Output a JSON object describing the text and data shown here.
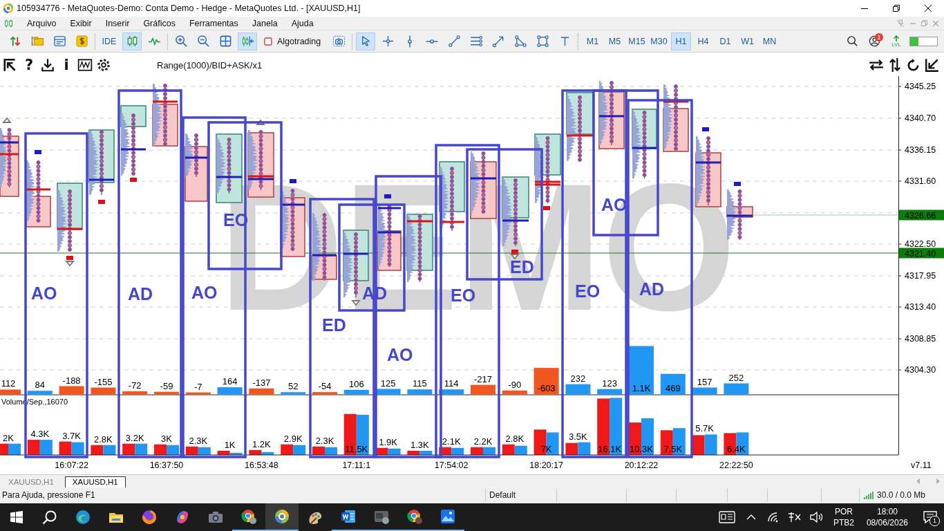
{
  "window": {
    "title": "105934776 - MetaQuotes-Demo: Conta Demo - Hedge - MetaQuotes Ltd. - [XAUUSD,H1]"
  },
  "menu": [
    "Arquivo",
    "Exibir",
    "Inserir",
    "Gráficos",
    "Ferramentas",
    "Janela",
    "Ajuda"
  ],
  "toolbar": {
    "ide_label": "IDE",
    "candles_selected": true,
    "autoscroll_selected": true,
    "algotrading": {
      "label": "Algotrading",
      "enabled": false
    },
    "cursor_selected": true,
    "timeframes": [
      {
        "label": "M1",
        "selected": false
      },
      {
        "label": "M5",
        "selected": false
      },
      {
        "label": "M15",
        "selected": false
      },
      {
        "label": "M30",
        "selected": false
      },
      {
        "label": "H1",
        "selected": true
      },
      {
        "label": "H4",
        "selected": false
      },
      {
        "label": "D1",
        "selected": false
      },
      {
        "label": "W1",
        "selected": false
      },
      {
        "label": "MN",
        "selected": false
      }
    ],
    "notification_count": "1",
    "lvl_label": "LVL",
    "meter": {
      "level": 0.3
    }
  },
  "chart": {
    "help_glyph": "?",
    "info_glyph": "i",
    "indicator": "Range(1000)/BID+ASK/x1",
    "watermark": "DEMO",
    "annotations": [
      {
        "label": "AO"
      },
      {
        "label": "AD"
      },
      {
        "label": "AO"
      },
      {
        "label": "EO"
      },
      {
        "label": "ED"
      },
      {
        "label": "AD"
      },
      {
        "label": "AO"
      },
      {
        "label": "EO"
      },
      {
        "label": "ED"
      },
      {
        "label": "EO"
      },
      {
        "label": "AO"
      },
      {
        "label": "AD"
      }
    ],
    "price_axis": {
      "ticks": [
        "4345.25",
        "4340.70",
        "4336.15",
        "4331.60",
        "4322.50",
        "4317.95",
        "4313.40",
        "4308.85",
        "4304.30"
      ],
      "markers": [
        {
          "label": "4326.66"
        },
        {
          "label": "4321.40"
        }
      ]
    },
    "delta_row": [
      {
        "label": "112",
        "color": "#f0561d"
      },
      {
        "label": "84",
        "color": "#2196f3"
      },
      {
        "label": "-188",
        "color": "#f0561d"
      },
      {
        "label": "-155",
        "color": "#f0561d"
      },
      {
        "label": "-72",
        "color": "#f0561d"
      },
      {
        "label": "-59",
        "color": "#f0561d"
      },
      {
        "label": "-7",
        "color": "#f0561d"
      },
      {
        "label": "164",
        "color": "#2196f3"
      },
      {
        "label": "-137",
        "color": "#f0561d"
      },
      {
        "label": "52",
        "color": "#2196f3"
      },
      {
        "label": "-54",
        "color": "#f0561d"
      },
      {
        "label": "106",
        "color": "#2196f3"
      },
      {
        "label": "125",
        "color": "#2196f3"
      },
      {
        "label": "115",
        "color": "#2196f3"
      },
      {
        "label": "114",
        "color": "#2196f3"
      },
      {
        "label": "-217",
        "color": "#f0561d"
      },
      {
        "label": "-90",
        "color": "#f0561d"
      },
      {
        "label": "-603",
        "color": "#f0561d"
      },
      {
        "label": "232",
        "color": "#2196f3"
      },
      {
        "label": "123",
        "color": "#2196f3"
      },
      {
        "label": "1.1K",
        "color": "#2196f3"
      },
      {
        "label": "469",
        "color": "#2196f3"
      },
      {
        "label": "157",
        "color": "#2196f3"
      },
      {
        "label": "252",
        "color": "#2196f3"
      }
    ],
    "volume_window": {
      "title": "Volume/Sep.,16070",
      "totals": [
        "2K",
        "4.3K",
        "3.7K",
        "2.8K",
        "3.2K",
        "3K",
        "2.3K",
        "1K",
        "1.2K",
        "2.9K",
        "2.3K",
        "11.5K",
        "1.9K",
        "1.3K",
        "2.1K",
        "2.2K",
        "2.8K",
        "7K",
        "3.5K",
        "16.1K",
        "10.3K",
        "7.5K",
        "5.7K",
        "6.4K"
      ]
    },
    "time_axis": [
      "16:07:22",
      "16:37:50",
      "16:53:48",
      "17:11:1",
      "17:54:02",
      "18:20:17",
      "20:12:22",
      "22:22:50"
    ],
    "version": "v7.11"
  },
  "chart_tabs": [
    {
      "label": "XAUUSD,H1",
      "selected": false
    },
    {
      "label": "XAUUSD,H1",
      "selected": true
    }
  ],
  "status_bar": {
    "help": "Para Ajuda, pressione F1",
    "profile": "Default",
    "traffic": "30.0 / 0.0 Mb"
  },
  "taskbar": {
    "apps": [
      {
        "running": false,
        "active": false
      },
      {
        "running": false,
        "active": false
      },
      {
        "running": false,
        "active": false
      },
      {
        "running": false,
        "active": false
      },
      {
        "running": false,
        "active": false
      },
      {
        "running": true,
        "active": false
      },
      {
        "running": true,
        "active": true
      },
      {
        "running": false,
        "active": false
      },
      {
        "running": true,
        "active": false
      },
      {
        "running": true,
        "active": false
      },
      {
        "running": true,
        "active": false
      },
      {
        "running": true,
        "active": false
      }
    ],
    "language": "POR",
    "layout": "PTB2",
    "time": "18:00",
    "date": "08/06/2026",
    "notification_count": "1"
  }
}
